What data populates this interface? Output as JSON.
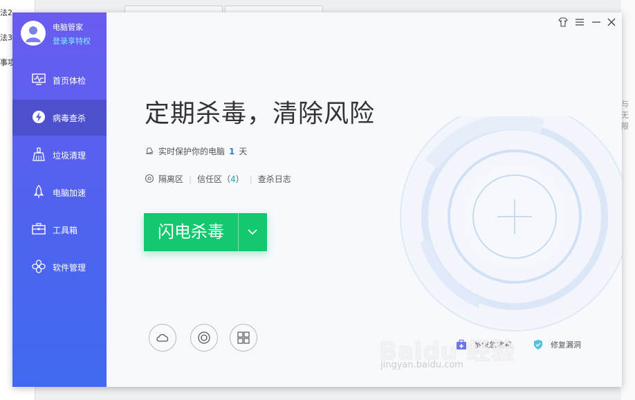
{
  "background_doc": {
    "left_lines": [
      "法2",
      "法3",
      "事项"
    ],
    "right_text": "与无限"
  },
  "user": {
    "name": "电脑管家",
    "login_label": "登录享特权"
  },
  "sidebar": {
    "items": [
      {
        "label": "首页体检",
        "icon": "monitor-icon"
      },
      {
        "label": "病毒查杀",
        "icon": "lightning-shield-icon"
      },
      {
        "label": "垃圾清理",
        "icon": "broom-icon"
      },
      {
        "label": "电脑加速",
        "icon": "rocket-icon"
      },
      {
        "label": "工具箱",
        "icon": "toolbox-icon"
      },
      {
        "label": "软件管理",
        "icon": "software-icon"
      }
    ],
    "active_index": 1
  },
  "titlebar": {
    "icons": [
      "skin-icon",
      "menu-icon",
      "minimize-icon",
      "close-icon"
    ]
  },
  "main": {
    "headline": "定期杀毒，清除风险",
    "protect_prefix": "实时保护你的电脑",
    "protect_days": "1",
    "protect_suffix": "天",
    "links": {
      "quarantine": "隔离区",
      "trust_prefix": "信任区（",
      "trust_count": "4",
      "trust_suffix": "）",
      "log": "查杀日志"
    },
    "scan_button": "闪电杀毒"
  },
  "bottom_tools": {
    "circle_icons": [
      "cloud-icon",
      "target-icon",
      "windows-icon"
    ],
    "rescue_label": "系统急救箱",
    "fix_label": "修复漏洞"
  },
  "watermark": {
    "main": "Baidu 经验",
    "sub": "jingyan.baidu.com"
  },
  "colors": {
    "sidebar_top": "#6a5cf0",
    "sidebar_bottom": "#3f6af0",
    "scan_green": "#13c86e",
    "days_blue": "#2b7dd9"
  }
}
